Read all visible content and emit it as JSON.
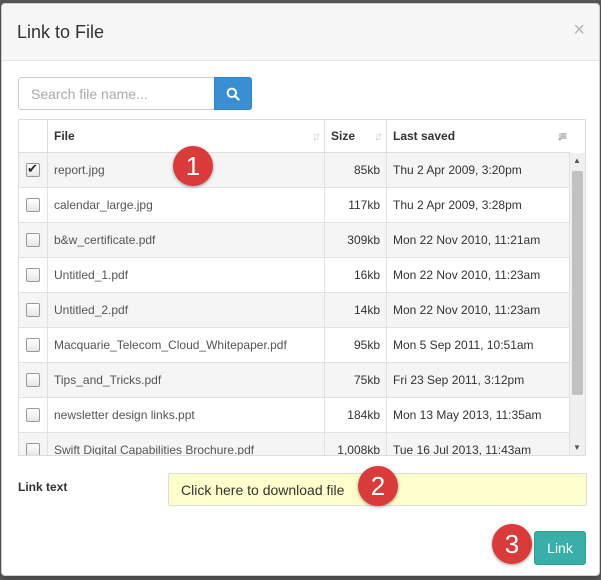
{
  "background": {
    "top_text": "",
    "bottom_text": ""
  },
  "dialog": {
    "title": "Link to File",
    "close_glyph": "×"
  },
  "search": {
    "placeholder": "Search file name...",
    "icon": "search-icon"
  },
  "table": {
    "columns": [
      {
        "label": "File",
        "sort_icon": "sort-icon"
      },
      {
        "label": "Size",
        "sort_icon": "sort-icon"
      },
      {
        "label": "Last saved",
        "sort_icon": "sort-desc-icon"
      }
    ],
    "rows": [
      {
        "checked": true,
        "file": "report.jpg",
        "size": "85kb",
        "saved": "Thu 2 Apr 2009, 3:20pm"
      },
      {
        "checked": false,
        "file": "calendar_large.jpg",
        "size": "117kb",
        "saved": "Thu 2 Apr 2009, 3:28pm"
      },
      {
        "checked": false,
        "file": "b&w_certificate.pdf",
        "size": "309kb",
        "saved": "Mon 22 Nov 2010, 11:21am"
      },
      {
        "checked": false,
        "file": "Untitled_1.pdf",
        "size": "16kb",
        "saved": "Mon 22 Nov 2010, 11:23am"
      },
      {
        "checked": false,
        "file": "Untitled_2.pdf",
        "size": "14kb",
        "saved": "Mon 22 Nov 2010, 11:23am"
      },
      {
        "checked": false,
        "file": "Macquarie_Telecom_Cloud_Whitepaper.pdf",
        "size": "95kb",
        "saved": "Mon 5 Sep 2011, 10:51am"
      },
      {
        "checked": false,
        "file": "Tips_and_Tricks.pdf",
        "size": "75kb",
        "saved": "Fri 23 Sep 2011, 3:12pm"
      },
      {
        "checked": false,
        "file": "newsletter design links.ppt",
        "size": "184kb",
        "saved": "Mon 13 May 2013, 11:35am"
      },
      {
        "checked": false,
        "file": "Swift Digital Capabilities Brochure.pdf",
        "size": "1,008kb",
        "saved": "Tue 16 Jul 2013, 11:43am"
      }
    ]
  },
  "link_text": {
    "label": "Link text",
    "value": "Click here to download file"
  },
  "link_button": {
    "label": "Link"
  },
  "markers": [
    "1",
    "2",
    "3"
  ],
  "colors": {
    "primary_blue": "#3a8fd2",
    "link_teal": "#3aafa9",
    "marker_red": "#d93a3a",
    "highlight_yellow": "#ffffcc"
  }
}
